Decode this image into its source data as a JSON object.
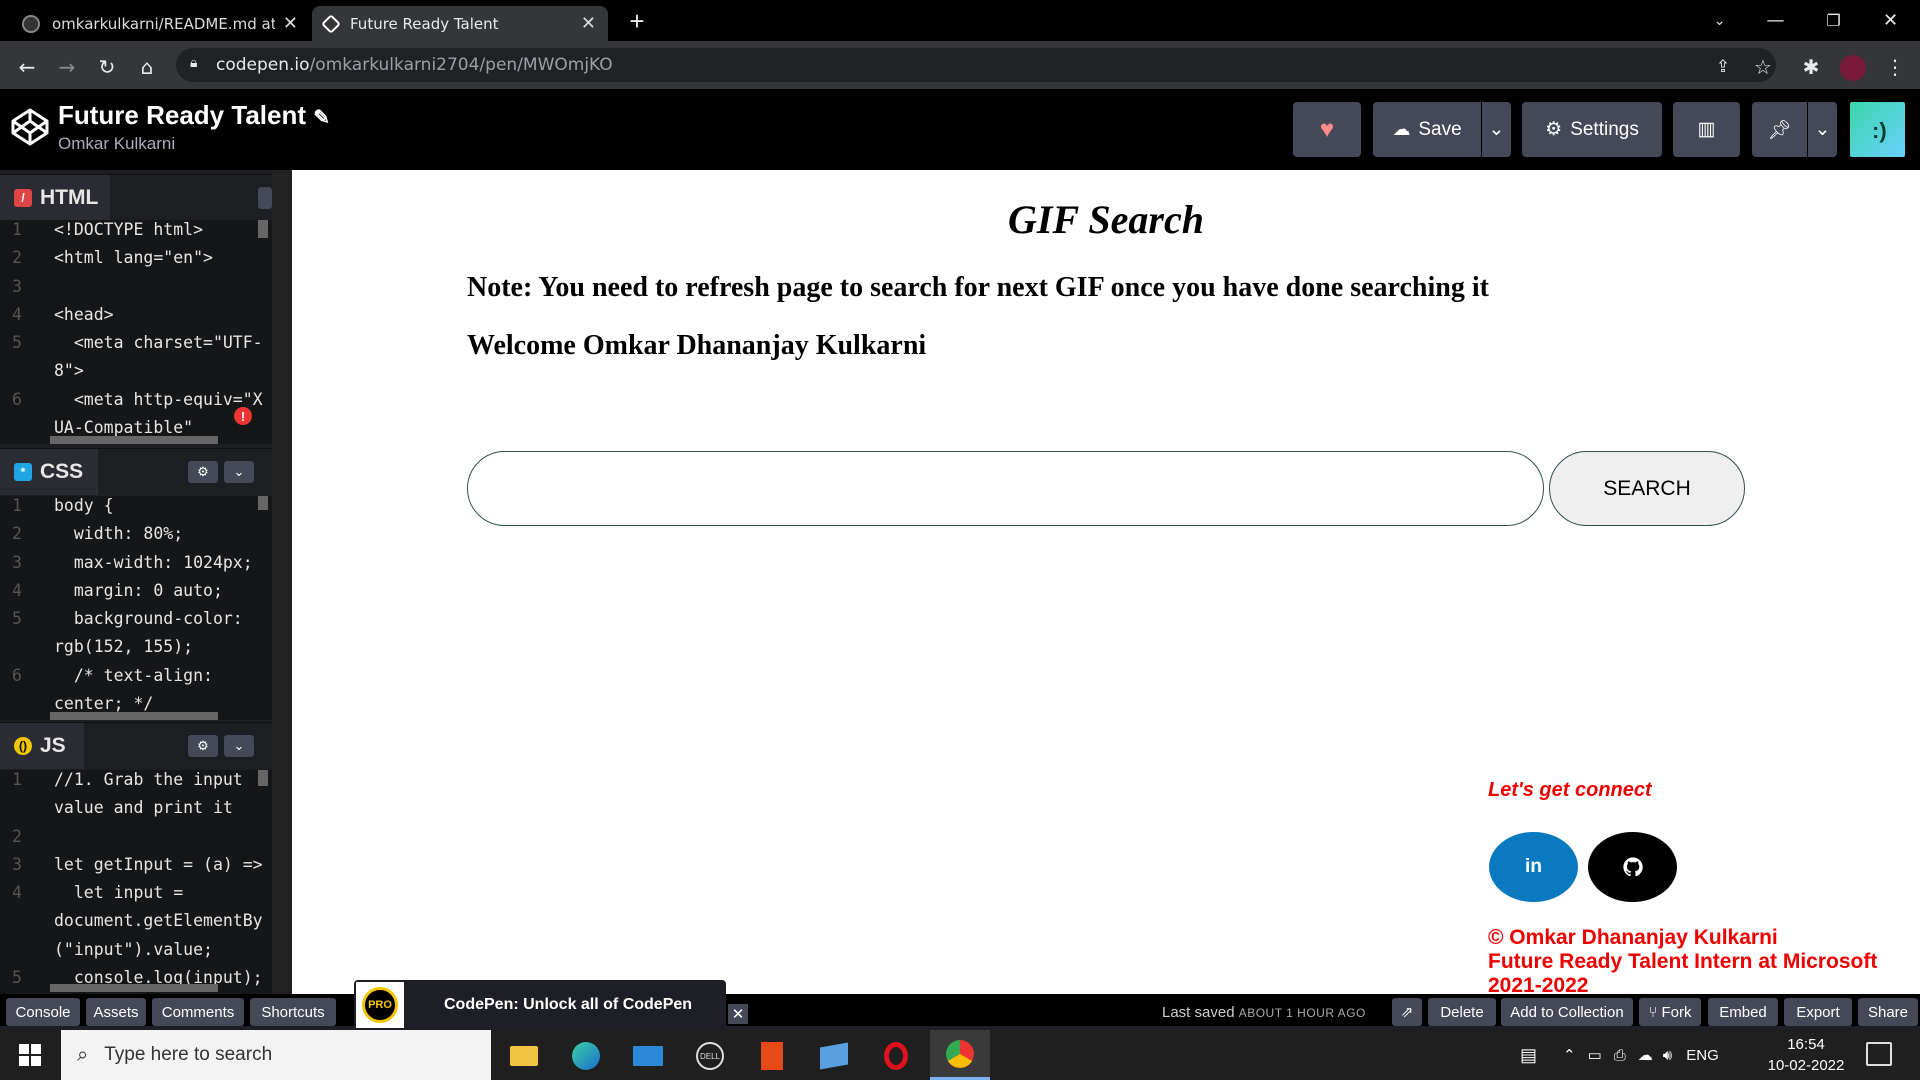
{
  "browser": {
    "tabs": [
      {
        "label": "omkarkulkarni/README.md at m"
      },
      {
        "label": "Future Ready Talent"
      }
    ],
    "new_tab": "+",
    "url_host": "codepen.io",
    "url_path": "/omkarkulkarni2704/pen/MWOmjKO"
  },
  "header": {
    "title": "Future Ready Talent",
    "author": "Omkar Kulkarni",
    "save_label": "Save",
    "settings_label": "Settings"
  },
  "editors": {
    "html": {
      "title": "HTML",
      "lines": [
        {
          "n": "1",
          "t": "<!DOCTYPE html>"
        },
        {
          "n": "2",
          "t": "<html lang=\"en\">"
        },
        {
          "n": "3",
          "t": ""
        },
        {
          "n": "4",
          "t": "<head>"
        },
        {
          "n": "5",
          "t": "  <meta charset=\"UTF-"
        },
        {
          "n": "",
          "t": "8\">"
        },
        {
          "n": "6",
          "t": "  <meta http-equiv=\"X"
        },
        {
          "n": "",
          "t": "UA-Compatible\""
        }
      ]
    },
    "css": {
      "title": "CSS",
      "lines": [
        {
          "n": "1",
          "t": "body {"
        },
        {
          "n": "2",
          "t": "  width: 80%;"
        },
        {
          "n": "3",
          "t": "  max-width: 1024px;"
        },
        {
          "n": "4",
          "t": "  margin: 0 auto;"
        },
        {
          "n": "5",
          "t": "  background-color:"
        },
        {
          "n": "",
          "t": "rgb(152, 155);"
        },
        {
          "n": "6",
          "t": "  /* text-align:"
        },
        {
          "n": "",
          "t": "center; */"
        }
      ]
    },
    "js": {
      "title": "JS",
      "lines": [
        {
          "n": "1",
          "t": "//1. Grab the input"
        },
        {
          "n": "",
          "t": "value and print it"
        },
        {
          "n": "2",
          "t": ""
        },
        {
          "n": "3",
          "t": "let getInput = (a) =>"
        },
        {
          "n": "4",
          "t": "  let input ="
        },
        {
          "n": "",
          "t": "document.getElementBy"
        },
        {
          "n": "",
          "t": "(\"input\").value;"
        },
        {
          "n": "5",
          "t": "  console.log(input);"
        }
      ]
    }
  },
  "preview": {
    "heading": "GIF Search",
    "note": "Note: You need to refresh page to search for next GIF once you have done searching it",
    "welcome": "Welcome Omkar Dhananjay Kulkarni",
    "search_value": "",
    "search_button": "SEARCH",
    "connect": "Let's get connect",
    "linkedin": "in",
    "copyright_line1": "© Omkar Dhananjay Kulkarni",
    "copyright_line2": "Future Ready Talent Intern at Microsoft",
    "copyright_line3": "2021-2022"
  },
  "footer": {
    "left_buttons": [
      "Console",
      "Assets",
      "Comments",
      "Shortcuts"
    ],
    "promo": "CodePen: Unlock all of CodePen",
    "promo_badge": "PRO",
    "last_saved_prefix": "Last saved",
    "last_saved_time": "ABOUT 1 HOUR AGO",
    "right_buttons": [
      "Delete",
      "Add to Collection",
      "Fork",
      "Embed",
      "Export",
      "Share"
    ]
  },
  "taskbar": {
    "search_placeholder": "Type here to search",
    "language": "ENG",
    "time": "16:54",
    "date": "10-02-2022"
  },
  "colors": {
    "accent_red": "#e00000",
    "linkedin_blue": "#0a7ac0",
    "codepen_button": "#444857"
  }
}
